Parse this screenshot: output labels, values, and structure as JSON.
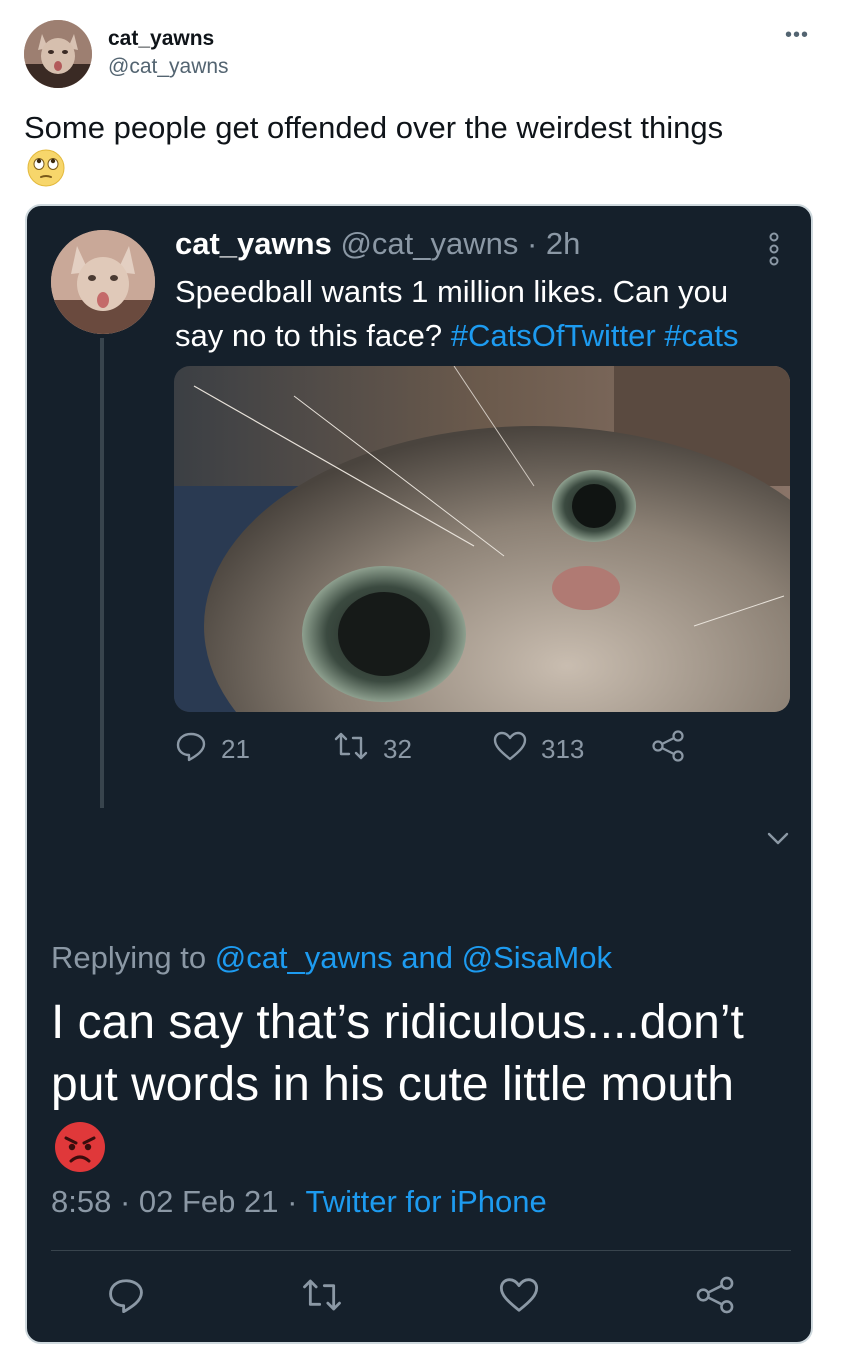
{
  "outer_tweet": {
    "display_name": "cat_yawns",
    "handle": "@cat_yawns",
    "more_label": "•••",
    "text": "Some people get offended over the weirdest things",
    "emoji": "rolling-eyes-emoji"
  },
  "embedded": {
    "display_name": "cat_yawns",
    "handle_time": "@cat_yawns · 2h",
    "text_line1": "Speedball wants 1 million likes. Can you",
    "text_line2_plain": "say no to this face? ",
    "hashtag1": "#CatsOfTwitter",
    "hashtag2": "#cats",
    "actions": {
      "replies": "21",
      "retweets": "32",
      "likes": "313"
    },
    "reply_prefix": "Replying to ",
    "reply_user1": "@cat_yawns",
    "reply_and": " and ",
    "reply_user2": "@SisaMok",
    "reply_text": "I can say that’s ridiculous....don’t put words in his cute little mouth",
    "reply_emoji": "angry-face-emoji",
    "meta_time": "8:58 · 02 Feb 21 · ",
    "meta_source": "Twitter for iPhone"
  },
  "colors": {
    "dark_bg": "#15202b",
    "accent": "#1d9bf0",
    "muted": "#8b98a5"
  }
}
